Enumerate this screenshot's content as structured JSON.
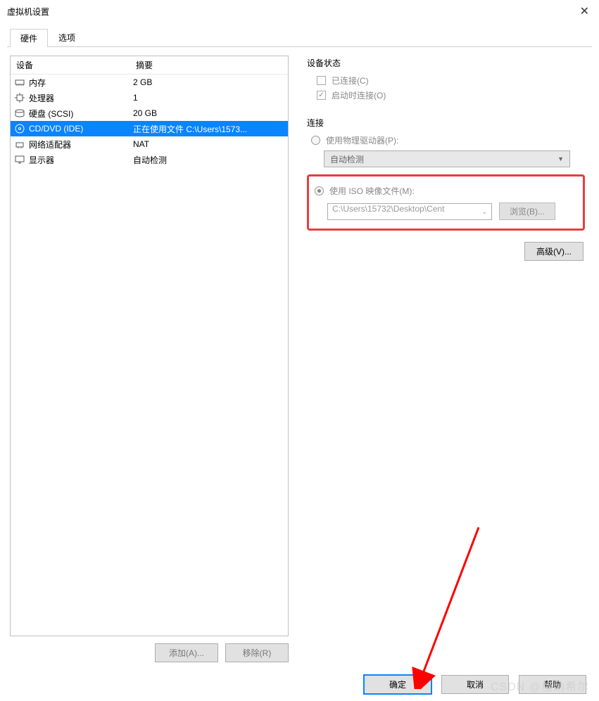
{
  "window": {
    "title": "虚拟机设置"
  },
  "tabs": {
    "hardware": "硬件",
    "options": "选项"
  },
  "list_header": {
    "device": "设备",
    "summary": "摘要"
  },
  "devices": [
    {
      "name": "内存",
      "summary": "2 GB",
      "icon": "memory"
    },
    {
      "name": "处理器",
      "summary": "1",
      "icon": "cpu"
    },
    {
      "name": "硬盘 (SCSI)",
      "summary": "20 GB",
      "icon": "disk"
    },
    {
      "name": "CD/DVD (IDE)",
      "summary": "正在使用文件 C:\\Users\\1573...",
      "icon": "cd",
      "selected": true
    },
    {
      "name": "网络适配器",
      "summary": "NAT",
      "icon": "net"
    },
    {
      "name": "显示器",
      "summary": "自动检测",
      "icon": "display"
    }
  ],
  "left_buttons": {
    "add": "添加(A)...",
    "remove": "移除(R)"
  },
  "status": {
    "title": "设备状态",
    "connected": "已连接(C)",
    "connect_on_start": "启动时连接(O)"
  },
  "connection": {
    "title": "连接",
    "use_physical": "使用物理驱动器(P):",
    "physical_value": "自动检测",
    "use_iso": "使用 ISO 映像文件(M):",
    "iso_value": "C:\\Users\\15732\\Desktop\\Cent",
    "browse": "浏览(B)..."
  },
  "advanced": "高级(V)...",
  "footer": {
    "ok": "确定",
    "cancel": "取消",
    "help": "帮助"
  },
  "watermark": "CSDN @格納希尔"
}
